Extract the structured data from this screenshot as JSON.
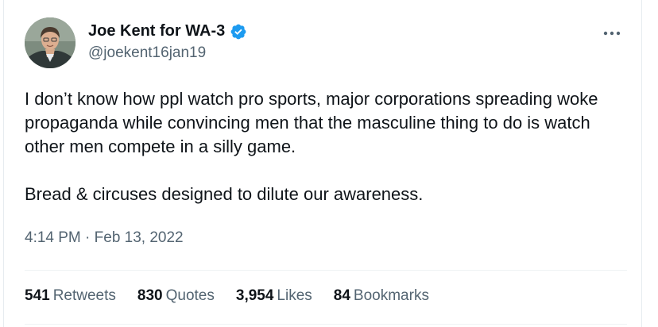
{
  "author": {
    "display_name": "Joe Kent for WA-3",
    "handle": "@joekent16jan19",
    "verified": true
  },
  "tweet": {
    "paragraphs": [
      "I don’t know how ppl watch pro sports, major corporations spreading woke propaganda while convincing men that the masculine thing to do is watch other men compete in a silly game.",
      "Bread & circuses designed to dilute our awareness."
    ],
    "timestamp": "4:14 PM · Feb 13, 2022"
  },
  "stats": [
    {
      "count": "541",
      "label": "Retweets"
    },
    {
      "count": "830",
      "label": "Quotes"
    },
    {
      "count": "3,954",
      "label": "Likes"
    },
    {
      "count": "84",
      "label": "Bookmarks"
    }
  ],
  "colors": {
    "text": "#0f1419",
    "secondary": "#536471",
    "verified": "#1d9bf0",
    "divider": "#eff3f4"
  },
  "icons": {
    "more": "more-icon",
    "verified": "verified-badge-icon"
  }
}
